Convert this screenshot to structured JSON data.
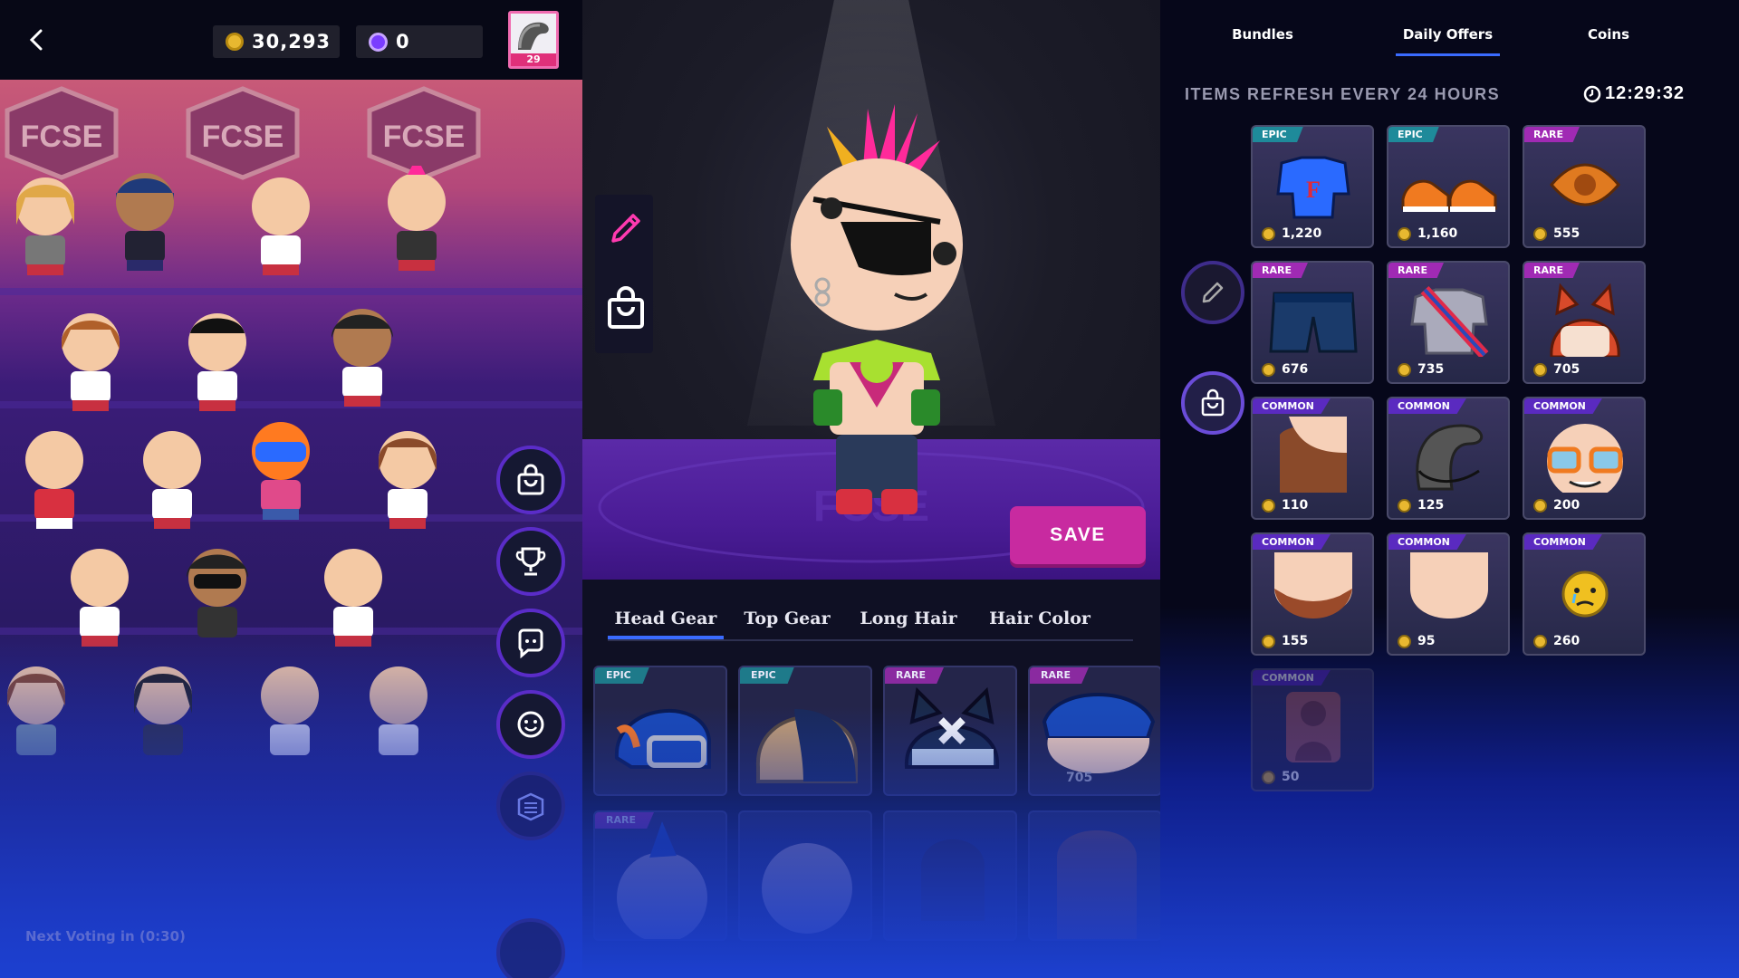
{
  "header": {
    "coins": "30,293",
    "gems": "0",
    "level": "29"
  },
  "stadium": {
    "banner_text": "FCSE",
    "voting_text": "Next Voting in (0:30)"
  },
  "sidenav": {
    "items": [
      "shop",
      "trophy",
      "chat",
      "emote",
      "stadium"
    ]
  },
  "customize": {
    "save_label": "SAVE",
    "tabs": [
      "Head Gear",
      "Top Gear",
      "Long Hair",
      "Hair Color"
    ],
    "active_tab": "Head Gear",
    "inventory": [
      {
        "rarity": "EPIC",
        "name": "knights-helmet"
      },
      {
        "rarity": "EPIC",
        "name": "gold-visor-helmet"
      },
      {
        "rarity": "RARE",
        "name": "cat-ears-helmet"
      },
      {
        "rarity": "RARE",
        "name": "blue-beanie",
        "price": "705"
      },
      {
        "rarity": "RARE",
        "name": "mohawk-hair"
      }
    ]
  },
  "shop": {
    "tabs": [
      "Bundles",
      "Daily Offers",
      "Coins"
    ],
    "active_tab": "Daily Offers",
    "refresh_text": "ITEMS REFRESH EVERY 24 HOURS",
    "timer": "12:29:32",
    "offers": [
      {
        "rarity": "EPIC",
        "price": "1,220",
        "item": "football-jersey"
      },
      {
        "rarity": "EPIC",
        "price": "1,160",
        "item": "sneakers"
      },
      {
        "rarity": "RARE",
        "price": "555",
        "item": "eye-patch"
      },
      {
        "rarity": "RARE",
        "price": "676",
        "item": "denim-shorts"
      },
      {
        "rarity": "RARE",
        "price": "735",
        "item": "sash-shirt"
      },
      {
        "rarity": "RARE",
        "price": "705",
        "item": "fox-hood"
      },
      {
        "rarity": "COMMON",
        "price": "110",
        "item": "long-hair"
      },
      {
        "rarity": "COMMON",
        "price": "125",
        "item": "swept-hair"
      },
      {
        "rarity": "COMMON",
        "price": "200",
        "item": "orange-glasses"
      },
      {
        "rarity": "COMMON",
        "price": "155",
        "item": "beard"
      },
      {
        "rarity": "COMMON",
        "price": "95",
        "item": "skin-tone"
      },
      {
        "rarity": "COMMON",
        "price": "260",
        "item": "crying-emote"
      },
      {
        "rarity": "COMMON",
        "price": "50",
        "item": "silhouette"
      }
    ]
  },
  "colors": {
    "accent_blue": "#3a6bff",
    "save_magenta": "#c82aa0",
    "epic": "#1e8a9a",
    "rare": "#a02ab4",
    "common": "#5a2ac0",
    "coin_gold": "#e8b830"
  }
}
